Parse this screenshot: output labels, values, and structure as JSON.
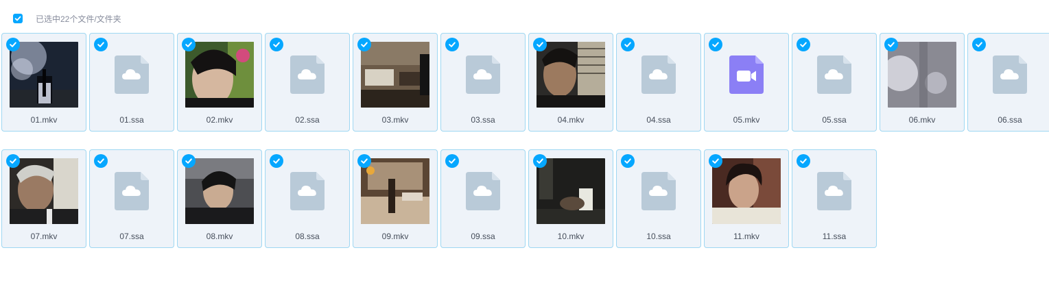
{
  "toolbar": {
    "selection_text": "已选中22个文件/文件夹",
    "checked": true
  },
  "colors": {
    "accent": "#06a7ff",
    "tile_bg": "#eef3f9",
    "tile_border": "#9ed7f2",
    "doc_icon": "#b9cad8",
    "video_icon": "#8b7ff5"
  },
  "files": [
    {
      "name": "01.mkv",
      "kind": "thumb",
      "icon": "video-thumbnail"
    },
    {
      "name": "01.ssa",
      "kind": "doc",
      "icon": "cloud-file-icon"
    },
    {
      "name": "02.mkv",
      "kind": "thumb",
      "icon": "video-thumbnail"
    },
    {
      "name": "02.ssa",
      "kind": "doc",
      "icon": "cloud-file-icon"
    },
    {
      "name": "03.mkv",
      "kind": "thumb",
      "icon": "video-thumbnail"
    },
    {
      "name": "03.ssa",
      "kind": "doc",
      "icon": "cloud-file-icon"
    },
    {
      "name": "04.mkv",
      "kind": "thumb",
      "icon": "video-thumbnail"
    },
    {
      "name": "04.ssa",
      "kind": "doc",
      "icon": "cloud-file-icon"
    },
    {
      "name": "05.mkv",
      "kind": "video",
      "icon": "video-file-icon"
    },
    {
      "name": "05.ssa",
      "kind": "doc",
      "icon": "cloud-file-icon"
    },
    {
      "name": "06.mkv",
      "kind": "thumb",
      "icon": "video-thumbnail"
    },
    {
      "name": "06.ssa",
      "kind": "doc",
      "icon": "cloud-file-icon"
    },
    {
      "name": "07.mkv",
      "kind": "thumb",
      "icon": "video-thumbnail"
    },
    {
      "name": "07.ssa",
      "kind": "doc",
      "icon": "cloud-file-icon"
    },
    {
      "name": "08.mkv",
      "kind": "thumb",
      "icon": "video-thumbnail"
    },
    {
      "name": "08.ssa",
      "kind": "doc",
      "icon": "cloud-file-icon"
    },
    {
      "name": "09.mkv",
      "kind": "thumb",
      "icon": "video-thumbnail"
    },
    {
      "name": "09.ssa",
      "kind": "doc",
      "icon": "cloud-file-icon"
    },
    {
      "name": "10.mkv",
      "kind": "thumb",
      "icon": "video-thumbnail"
    },
    {
      "name": "10.ssa",
      "kind": "doc",
      "icon": "cloud-file-icon"
    },
    {
      "name": "11.mkv",
      "kind": "thumb",
      "icon": "video-thumbnail"
    },
    {
      "name": "11.ssa",
      "kind": "doc",
      "icon": "cloud-file-icon"
    }
  ]
}
